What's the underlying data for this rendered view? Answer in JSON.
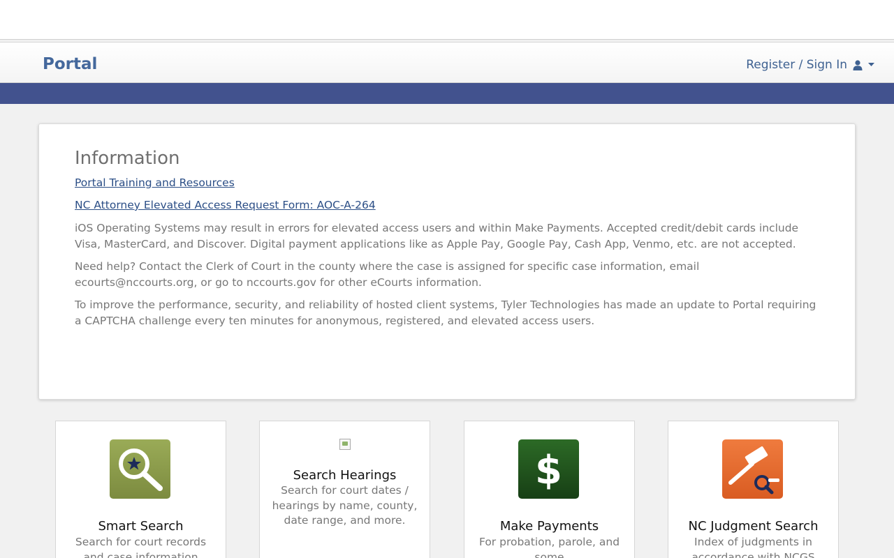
{
  "header": {
    "brand": "Portal",
    "signin_label": "Register / Sign In"
  },
  "info": {
    "title": "Information",
    "links": [
      "Portal Training and Resources",
      "NC Attorney Elevated Access Request Form: AOC-A-264"
    ],
    "paragraphs": [
      "iOS Operating Systems may result in errors for elevated access users and within Make Payments. Accepted credit/debit cards include Visa, MasterCard, and Discover. Digital payment applications like as Apple Pay, Google Pay, Cash App, Venmo, etc. are not accepted.",
      "Need help? Contact the Clerk of Court in the county where the case is assigned for specific case information, email ecourts@nccourts.org, or go to nccourts.gov for other eCourts information.",
      "To improve the performance, security, and reliability of hosted client systems, Tyler Technologies has made an update to Portal requiring a CAPTCHA challenge every ten minutes for anonymous, registered, and elevated access users."
    ]
  },
  "tiles": [
    {
      "title": "Smart Search",
      "description": "Search for court records and case information",
      "icon": "magnifier-star-icon",
      "color": "#8a9a4c"
    },
    {
      "title": "Search Hearings",
      "description": "Search for court dates / hearings by name, county, date range, and more.",
      "icon": "broken-image-icon"
    },
    {
      "title": "Make Payments",
      "description": "For probation, parole, and some",
      "icon": "dollar-icon",
      "color": "#1f4f1c"
    },
    {
      "title": "NC Judgment Search",
      "description": "Index of judgments in accordance with NCGS",
      "icon": "gavel-search-icon",
      "color": "#e6692f"
    }
  ],
  "colors": {
    "brand": "#44689c",
    "bluebar": "#42528e",
    "link": "#2b4e86"
  }
}
